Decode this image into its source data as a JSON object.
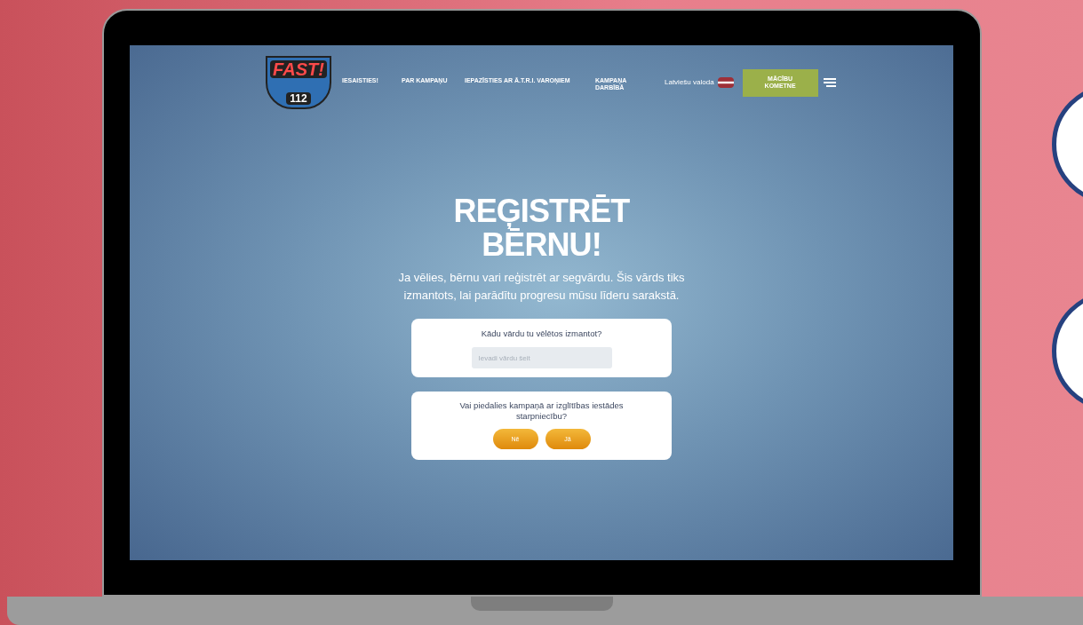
{
  "logo": {
    "title": "FAST!",
    "number": "112"
  },
  "nav": {
    "items": [
      {
        "label": "IESAISTIES!"
      },
      {
        "label": "PAR KAMPAŅU"
      },
      {
        "label": "IEPAZĪSTIES AR Ā.T.R.I. VAROŅIEM"
      },
      {
        "label": "KAMPAŅA DARBĪBĀ"
      }
    ],
    "language": "Latviešu valoda",
    "cta": "MĀCĪBU KOMETNE"
  },
  "hero": {
    "title": "REĢISTRĒT BĒRNU!",
    "text": "Ja vēlies, bērnu vari reģistrēt ar segvārdu. Šis vārds tiks izmantots, lai parādītu progresu mūsu līderu sarakstā."
  },
  "name_card": {
    "question": "Kādu vārdu tu vēlētos izmantot?",
    "placeholder": "Ievadi vārdu šeit"
  },
  "school_card": {
    "question": "Vai piedalies kampaņā ar izglītības iestādes starpniecību?",
    "buttons": [
      "Nē",
      "Jā"
    ]
  }
}
